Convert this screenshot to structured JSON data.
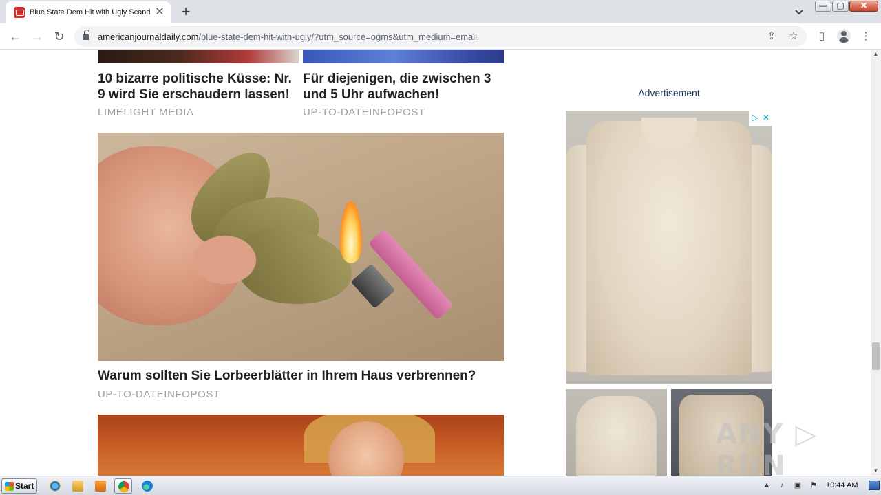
{
  "browser": {
    "tab_title": "Blue State Dem Hit with Ugly Scanda",
    "tab_close": "✕",
    "new_tab": "+",
    "url_domain": "americanjournaldaily.com",
    "url_path": "/blue-state-dem-hit-with-ugly/?utm_source=ogms&utm_medium=email",
    "back_icon": "←",
    "forward_icon": "→",
    "reload_icon": "↻",
    "share_icon": "⇪",
    "bookmark_icon": "☆",
    "sidepanel_icon": "▯",
    "menu_icon": "⋮",
    "tablist_icon": "⌄",
    "window_min": "—",
    "window_max": "▢",
    "window_close": "✕"
  },
  "page": {
    "cards": [
      {
        "title": "10 bizarre politische Küsse: Nr. 9 wird Sie erschaudern lassen!",
        "source": "LIMELIGHT MEDIA"
      },
      {
        "title": "Für diejenigen, die zwischen 3 und 5 Uhr aufwachen!",
        "source": "UP-TO-DATEINFOPOST"
      },
      {
        "title": "Warum sollten Sie Lorbeerblätter in Ihrem Haus verbrennen?",
        "source": "UP-TO-DATEINFOPOST"
      }
    ],
    "sidebar": {
      "ad_label": "Advertisement",
      "adchoices_icon": "▷",
      "ad_close_icon": "✕"
    },
    "watermark": "ANY ▷ RUN"
  },
  "scrollbar": {
    "up": "▲",
    "down": "▼"
  },
  "taskbar": {
    "start_label": "Start",
    "clock": "10:44 AM",
    "tray_icons": [
      "▲",
      "♪",
      "▣",
      "⚑"
    ]
  },
  "colors": {
    "tab_strip": "#dee1e6",
    "card_title": "#222222",
    "card_source": "#a0a0a0",
    "ad_label": "#1b3a5a"
  }
}
